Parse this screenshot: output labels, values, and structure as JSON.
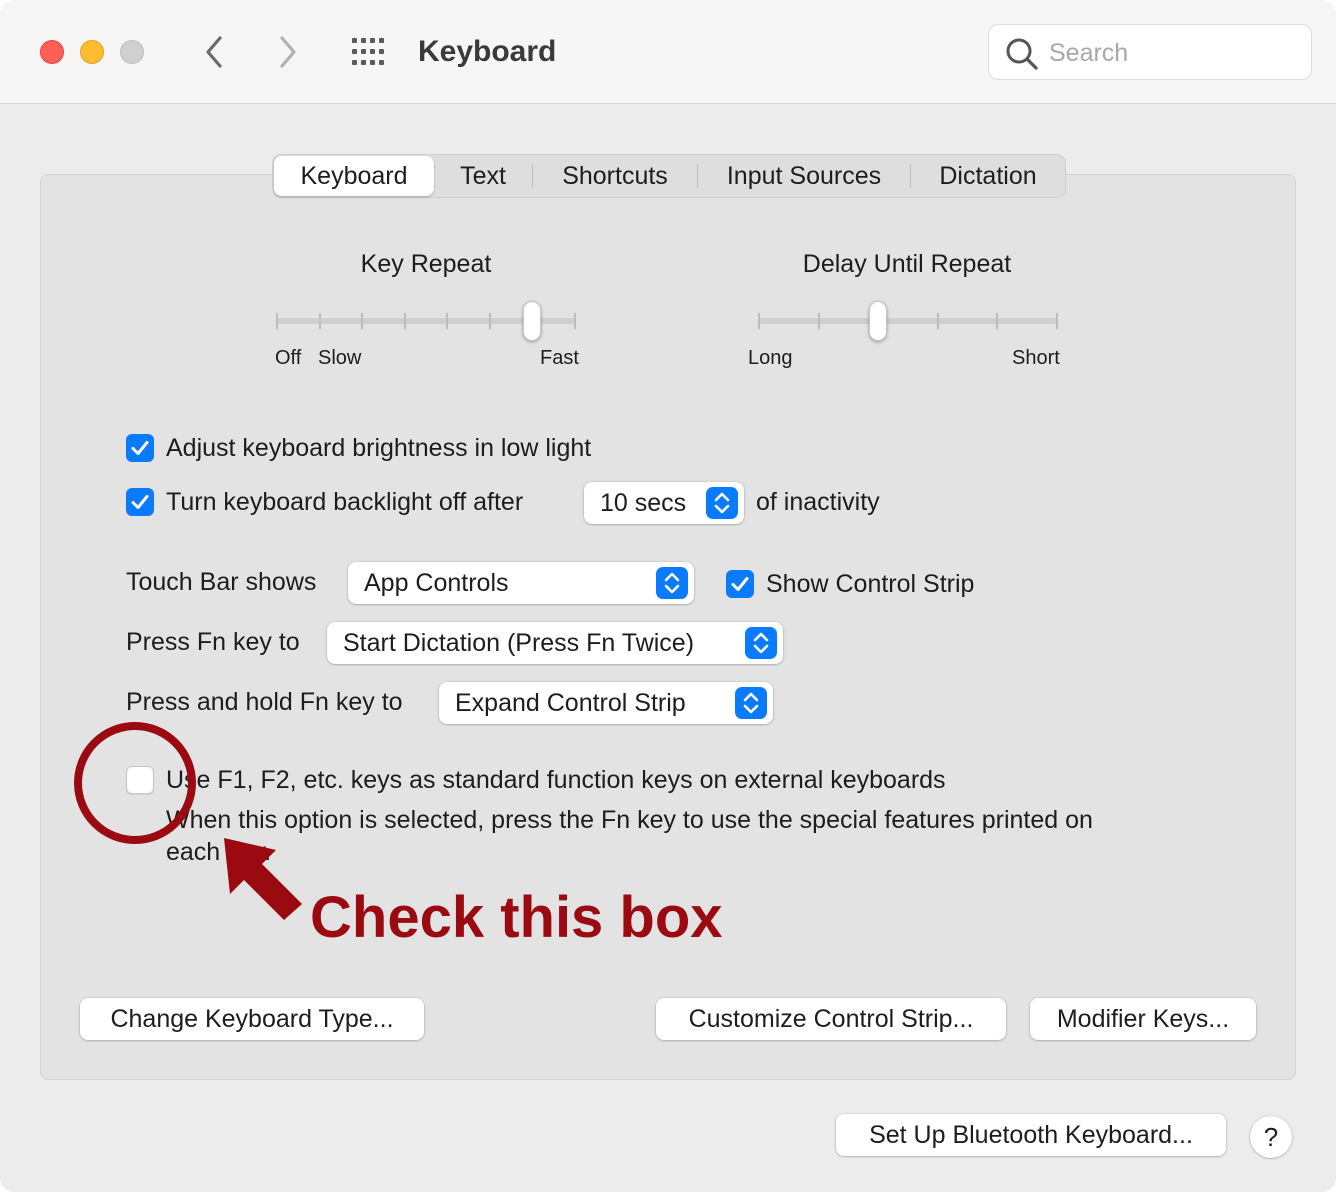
{
  "window": {
    "title": "Keyboard",
    "search_placeholder": "Search"
  },
  "tabs": [
    {
      "label": "Keyboard",
      "active": true
    },
    {
      "label": "Text",
      "active": false
    },
    {
      "label": "Shortcuts",
      "active": false
    },
    {
      "label": "Input Sources",
      "active": false
    },
    {
      "label": "Dictation",
      "active": false
    }
  ],
  "key_repeat": {
    "title": "Key Repeat",
    "label_off": "Off",
    "label_slow": "Slow",
    "label_fast": "Fast",
    "steps": 8,
    "value_step": 6
  },
  "delay_until_repeat": {
    "title": "Delay Until Repeat",
    "label_long": "Long",
    "label_short": "Short",
    "steps": 6,
    "value_step": 2
  },
  "options": {
    "adjust_brightness": {
      "label": "Adjust keyboard brightness in low light",
      "checked": true
    },
    "backlight_off": {
      "label": "Turn keyboard backlight off after",
      "checked": true,
      "popup_value": "10 secs",
      "suffix": "of inactivity"
    },
    "touch_bar": {
      "label": "Touch Bar shows",
      "popup_value": "App Controls"
    },
    "show_control_strip": {
      "label": "Show Control Strip",
      "checked": true
    },
    "press_fn": {
      "label": "Press Fn key to",
      "popup_value": "Start Dictation (Press Fn Twice)"
    },
    "hold_fn": {
      "label": "Press and hold Fn key to",
      "popup_value": "Expand Control Strip"
    },
    "function_keys": {
      "label_line1": "Use F1, F2, etc. keys as standard function keys on external keyboards",
      "label_line2": "When this option is selected, press the Fn key to use the special features printed on",
      "label_line3": "each key.",
      "checked": false
    }
  },
  "buttons": {
    "change_keyboard_type": "Change Keyboard Type...",
    "customize_control_strip": "Customize Control Strip...",
    "modifier_keys": "Modifier Keys...",
    "bluetooth_keyboard": "Set Up Bluetooth Keyboard...",
    "help": "?"
  },
  "annotation": {
    "text": "Check this box",
    "color": "#9b0a10"
  },
  "colors": {
    "accent": "#0a7aff"
  }
}
